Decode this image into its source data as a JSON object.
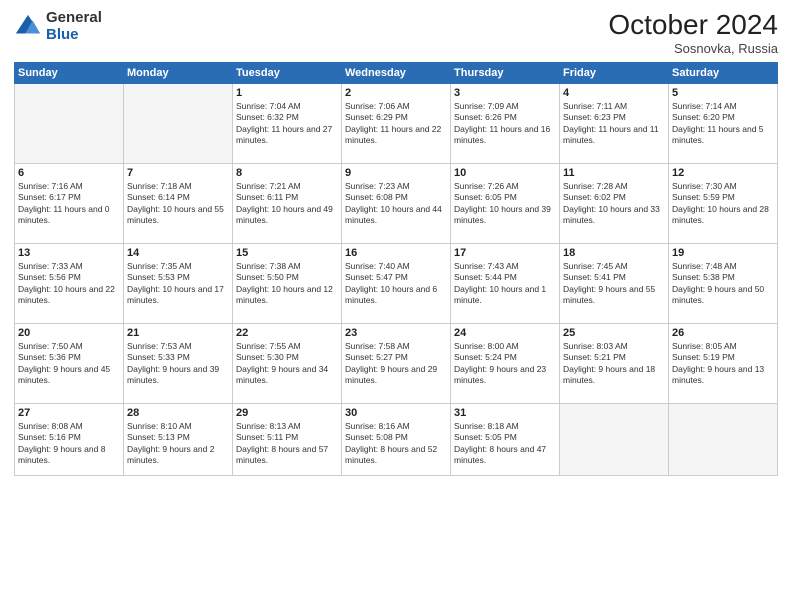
{
  "header": {
    "logo_general": "General",
    "logo_blue": "Blue",
    "month_title": "October 2024",
    "location": "Sosnovka, Russia"
  },
  "days_of_week": [
    "Sunday",
    "Monday",
    "Tuesday",
    "Wednesday",
    "Thursday",
    "Friday",
    "Saturday"
  ],
  "weeks": [
    [
      {
        "day": "",
        "empty": true
      },
      {
        "day": "",
        "empty": true
      },
      {
        "day": "1",
        "sunrise": "Sunrise: 7:04 AM",
        "sunset": "Sunset: 6:32 PM",
        "daylight": "Daylight: 11 hours and 27 minutes."
      },
      {
        "day": "2",
        "sunrise": "Sunrise: 7:06 AM",
        "sunset": "Sunset: 6:29 PM",
        "daylight": "Daylight: 11 hours and 22 minutes."
      },
      {
        "day": "3",
        "sunrise": "Sunrise: 7:09 AM",
        "sunset": "Sunset: 6:26 PM",
        "daylight": "Daylight: 11 hours and 16 minutes."
      },
      {
        "day": "4",
        "sunrise": "Sunrise: 7:11 AM",
        "sunset": "Sunset: 6:23 PM",
        "daylight": "Daylight: 11 hours and 11 minutes."
      },
      {
        "day": "5",
        "sunrise": "Sunrise: 7:14 AM",
        "sunset": "Sunset: 6:20 PM",
        "daylight": "Daylight: 11 hours and 5 minutes."
      }
    ],
    [
      {
        "day": "6",
        "sunrise": "Sunrise: 7:16 AM",
        "sunset": "Sunset: 6:17 PM",
        "daylight": "Daylight: 11 hours and 0 minutes."
      },
      {
        "day": "7",
        "sunrise": "Sunrise: 7:18 AM",
        "sunset": "Sunset: 6:14 PM",
        "daylight": "Daylight: 10 hours and 55 minutes."
      },
      {
        "day": "8",
        "sunrise": "Sunrise: 7:21 AM",
        "sunset": "Sunset: 6:11 PM",
        "daylight": "Daylight: 10 hours and 49 minutes."
      },
      {
        "day": "9",
        "sunrise": "Sunrise: 7:23 AM",
        "sunset": "Sunset: 6:08 PM",
        "daylight": "Daylight: 10 hours and 44 minutes."
      },
      {
        "day": "10",
        "sunrise": "Sunrise: 7:26 AM",
        "sunset": "Sunset: 6:05 PM",
        "daylight": "Daylight: 10 hours and 39 minutes."
      },
      {
        "day": "11",
        "sunrise": "Sunrise: 7:28 AM",
        "sunset": "Sunset: 6:02 PM",
        "daylight": "Daylight: 10 hours and 33 minutes."
      },
      {
        "day": "12",
        "sunrise": "Sunrise: 7:30 AM",
        "sunset": "Sunset: 5:59 PM",
        "daylight": "Daylight: 10 hours and 28 minutes."
      }
    ],
    [
      {
        "day": "13",
        "sunrise": "Sunrise: 7:33 AM",
        "sunset": "Sunset: 5:56 PM",
        "daylight": "Daylight: 10 hours and 22 minutes."
      },
      {
        "day": "14",
        "sunrise": "Sunrise: 7:35 AM",
        "sunset": "Sunset: 5:53 PM",
        "daylight": "Daylight: 10 hours and 17 minutes."
      },
      {
        "day": "15",
        "sunrise": "Sunrise: 7:38 AM",
        "sunset": "Sunset: 5:50 PM",
        "daylight": "Daylight: 10 hours and 12 minutes."
      },
      {
        "day": "16",
        "sunrise": "Sunrise: 7:40 AM",
        "sunset": "Sunset: 5:47 PM",
        "daylight": "Daylight: 10 hours and 6 minutes."
      },
      {
        "day": "17",
        "sunrise": "Sunrise: 7:43 AM",
        "sunset": "Sunset: 5:44 PM",
        "daylight": "Daylight: 10 hours and 1 minute."
      },
      {
        "day": "18",
        "sunrise": "Sunrise: 7:45 AM",
        "sunset": "Sunset: 5:41 PM",
        "daylight": "Daylight: 9 hours and 55 minutes."
      },
      {
        "day": "19",
        "sunrise": "Sunrise: 7:48 AM",
        "sunset": "Sunset: 5:38 PM",
        "daylight": "Daylight: 9 hours and 50 minutes."
      }
    ],
    [
      {
        "day": "20",
        "sunrise": "Sunrise: 7:50 AM",
        "sunset": "Sunset: 5:36 PM",
        "daylight": "Daylight: 9 hours and 45 minutes."
      },
      {
        "day": "21",
        "sunrise": "Sunrise: 7:53 AM",
        "sunset": "Sunset: 5:33 PM",
        "daylight": "Daylight: 9 hours and 39 minutes."
      },
      {
        "day": "22",
        "sunrise": "Sunrise: 7:55 AM",
        "sunset": "Sunset: 5:30 PM",
        "daylight": "Daylight: 9 hours and 34 minutes."
      },
      {
        "day": "23",
        "sunrise": "Sunrise: 7:58 AM",
        "sunset": "Sunset: 5:27 PM",
        "daylight": "Daylight: 9 hours and 29 minutes."
      },
      {
        "day": "24",
        "sunrise": "Sunrise: 8:00 AM",
        "sunset": "Sunset: 5:24 PM",
        "daylight": "Daylight: 9 hours and 23 minutes."
      },
      {
        "day": "25",
        "sunrise": "Sunrise: 8:03 AM",
        "sunset": "Sunset: 5:21 PM",
        "daylight": "Daylight: 9 hours and 18 minutes."
      },
      {
        "day": "26",
        "sunrise": "Sunrise: 8:05 AM",
        "sunset": "Sunset: 5:19 PM",
        "daylight": "Daylight: 9 hours and 13 minutes."
      }
    ],
    [
      {
        "day": "27",
        "sunrise": "Sunrise: 8:08 AM",
        "sunset": "Sunset: 5:16 PM",
        "daylight": "Daylight: 9 hours and 8 minutes."
      },
      {
        "day": "28",
        "sunrise": "Sunrise: 8:10 AM",
        "sunset": "Sunset: 5:13 PM",
        "daylight": "Daylight: 9 hours and 2 minutes."
      },
      {
        "day": "29",
        "sunrise": "Sunrise: 8:13 AM",
        "sunset": "Sunset: 5:11 PM",
        "daylight": "Daylight: 8 hours and 57 minutes."
      },
      {
        "day": "30",
        "sunrise": "Sunrise: 8:16 AM",
        "sunset": "Sunset: 5:08 PM",
        "daylight": "Daylight: 8 hours and 52 minutes."
      },
      {
        "day": "31",
        "sunrise": "Sunrise: 8:18 AM",
        "sunset": "Sunset: 5:05 PM",
        "daylight": "Daylight: 8 hours and 47 minutes."
      },
      {
        "day": "",
        "empty": true
      },
      {
        "day": "",
        "empty": true
      }
    ]
  ]
}
